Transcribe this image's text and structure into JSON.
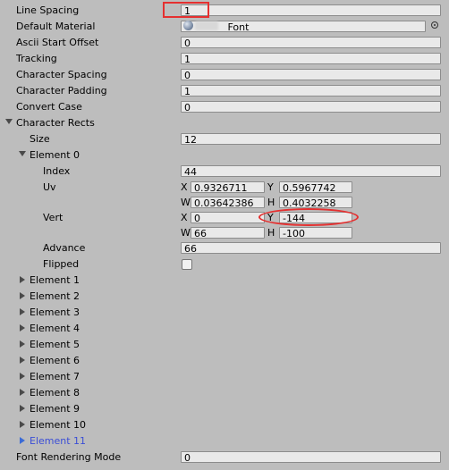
{
  "fields": {
    "line_spacing": {
      "label": "Line Spacing",
      "value": "1"
    },
    "default_material": {
      "label": "Default Material",
      "value": "_Font"
    },
    "ascii_start_offset": {
      "label": "Ascii Start Offset",
      "value": "0"
    },
    "tracking": {
      "label": "Tracking",
      "value": "1"
    },
    "character_spacing": {
      "label": "Character Spacing",
      "value": "0"
    },
    "character_padding": {
      "label": "Character Padding",
      "value": "1"
    },
    "convert_case": {
      "label": "Convert Case",
      "value": "0"
    },
    "font_rendering_mode": {
      "label": "Font Rendering Mode",
      "value": "0"
    }
  },
  "character_rects": {
    "label": "Character Rects",
    "size_label": "Size",
    "size_value": "12",
    "element0": {
      "label": "Element 0",
      "index_label": "Index",
      "index_value": "44",
      "uv_label": "Uv",
      "uv": {
        "x_label": "X",
        "x": "0.9326711",
        "y_label": "Y",
        "y": "0.5967742",
        "w_label": "W",
        "w": "0.03642386",
        "h_label": "H",
        "h": "0.4032258"
      },
      "vert_label": "Vert",
      "vert": {
        "x_label": "X",
        "x": "0",
        "y_label": "Y",
        "y": "-144",
        "w_label": "W",
        "w": "66",
        "h_label": "H",
        "h": "-100"
      },
      "advance_label": "Advance",
      "advance_value": "66",
      "flipped_label": "Flipped"
    },
    "elements": [
      "Element 1",
      "Element 2",
      "Element 3",
      "Element 4",
      "Element 5",
      "Element 6",
      "Element 7",
      "Element 8",
      "Element 9",
      "Element 10",
      "Element 11"
    ]
  },
  "colors": {
    "background": "#bdbdbd",
    "annotation": "#e53030",
    "selected": "#3b4ed6"
  }
}
